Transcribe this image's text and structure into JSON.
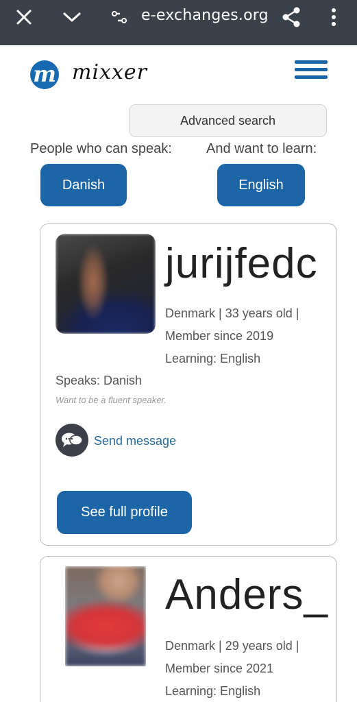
{
  "browser": {
    "url_faded": "",
    "url": "e-exchanges.org",
    "icons": [
      "close-icon",
      "chevron-down-icon",
      "tune-icon",
      "share-icon",
      "more-vert-icon"
    ]
  },
  "site": {
    "logo_letter": "m",
    "logo_text": "mixxer",
    "menu_icon": "hamburger-icon"
  },
  "search": {
    "advanced_label": "Advanced search",
    "speak_label": "People who can speak:",
    "learn_label": "And want to learn:",
    "speak_value": "Danish",
    "learn_value": "English"
  },
  "profiles": [
    {
      "username": "jurijfedc",
      "info_1": "Denmark | 33 years old |",
      "info_2": "Member since 2019",
      "info_3": "Learning: English",
      "speaks": "Speaks: Danish",
      "motto": "Want to be a fluent speaker.",
      "send_message": "Send message",
      "see_profile": "See full profile"
    },
    {
      "username": "Anders_",
      "info_1": "Denmark | 29 years old |",
      "info_2": "Member since 2021",
      "info_3": "Learning: English"
    }
  ],
  "colors": {
    "browser_bar": "#3b4148",
    "primary_blue": "#1c66a8",
    "link_blue": "#276a9a"
  }
}
